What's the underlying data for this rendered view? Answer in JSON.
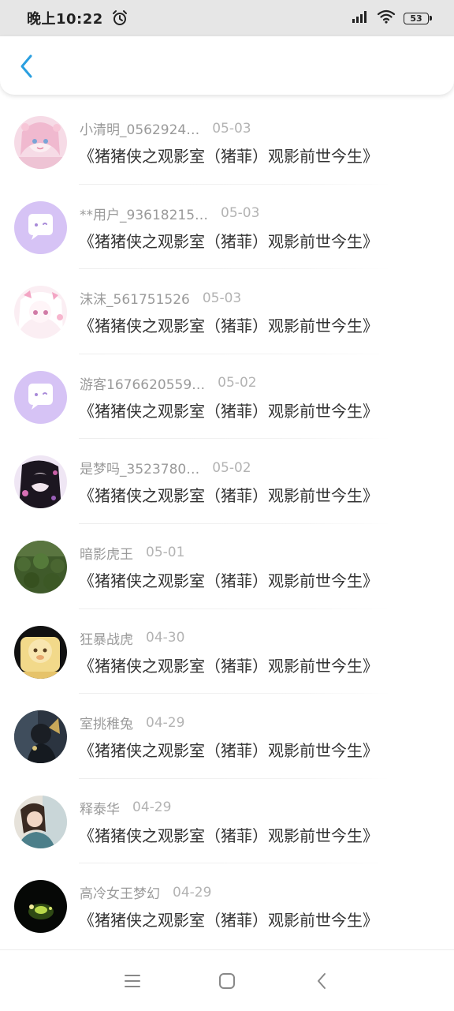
{
  "status_bar": {
    "time": "晚上10:22",
    "battery": "53",
    "icons": [
      "alarm-icon",
      "signal-icon",
      "wifi-icon",
      "battery-icon"
    ]
  },
  "header": {
    "back_icon": "chevron-left-icon",
    "accent_color": "#2a9fe0"
  },
  "items": [
    {
      "username": "小清明_0562924…",
      "date": "05-03",
      "title": "《猪猪侠之观影室（猪菲）观影前世今生》",
      "avatar": "anime-girl-pink"
    },
    {
      "username": "**用户_93618215…",
      "date": "05-03",
      "title": "《猪猪侠之观影室（猪菲）观影前世今生》",
      "avatar": "default-chat-bubble"
    },
    {
      "username": "沫沫_561751526",
      "date": "05-03",
      "title": "《猪猪侠之观影室（猪菲）观影前世今生》",
      "avatar": "anime-girl-white"
    },
    {
      "username": "游客1676620559…",
      "date": "05-02",
      "title": "《猪猪侠之观影室（猪菲）观影前世今生》",
      "avatar": "default-chat-bubble"
    },
    {
      "username": "是梦吗_3523780…",
      "date": "05-02",
      "title": "《猪猪侠之观影室（猪菲）观影前世今生》",
      "avatar": "anime-dark-hair"
    },
    {
      "username": "暗影虎王",
      "date": "05-01",
      "title": "《猪猪侠之观影室（猪菲）观影前世今生》",
      "avatar": "green-field"
    },
    {
      "username": "狂暴战虎",
      "date": "04-30",
      "title": "《猪猪侠之观影室（猪菲）观影前世今生》",
      "avatar": "yellow-figure"
    },
    {
      "username": "室挑稚兔",
      "date": "04-29",
      "title": "《猪猪侠之观影室（猪菲）观影前世今生》",
      "avatar": "dark-silhouette"
    },
    {
      "username": "释泰华",
      "date": "04-29",
      "title": "《猪猪侠之观影室（猪菲）观影前世今生》",
      "avatar": "girl-photo"
    },
    {
      "username": "高冷女王梦幻",
      "date": "04-29",
      "title": "《猪猪侠之观影室（猪菲）观影前世今生》",
      "avatar": "dark-night-light"
    }
  ],
  "nav_bar": {
    "buttons": [
      "menu-icon",
      "home-icon",
      "back-icon"
    ]
  }
}
